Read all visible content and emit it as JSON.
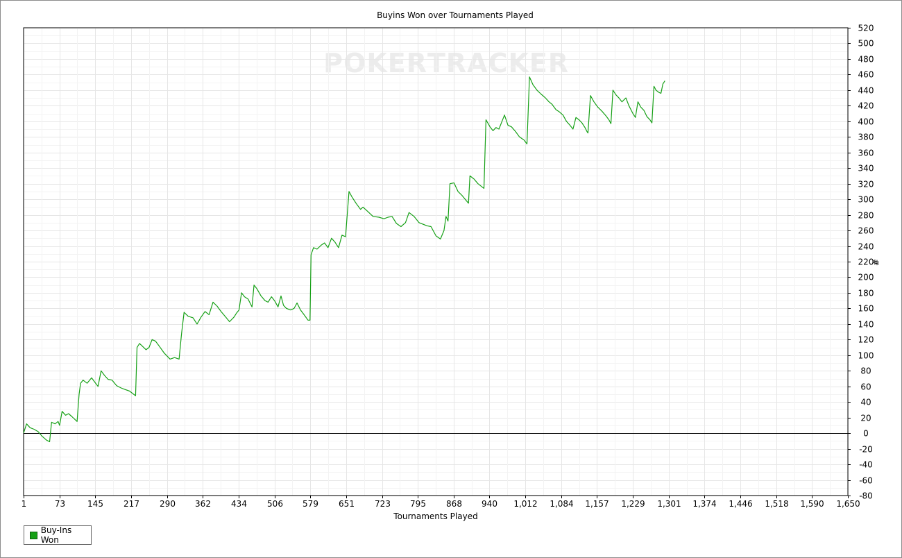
{
  "chart_data": {
    "type": "line",
    "title": "Buyins Won over Tournaments Played",
    "xlabel": "Tournaments Played",
    "ylabel": "#",
    "watermark": {
      "left": "POKER",
      "right": "TRACKER"
    },
    "xlim": [
      1,
      1650
    ],
    "ylim": [
      -80,
      520
    ],
    "x_ticks": [
      "1",
      "73",
      "145",
      "217",
      "290",
      "362",
      "434",
      "506",
      "579",
      "651",
      "723",
      "795",
      "868",
      "940",
      "1,012",
      "1,084",
      "1,157",
      "1,229",
      "1,301",
      "1,374",
      "1,446",
      "1,518",
      "1,590",
      "1,650"
    ],
    "y_ticks": [
      520,
      500,
      480,
      460,
      440,
      420,
      400,
      380,
      360,
      340,
      320,
      300,
      280,
      260,
      240,
      220,
      200,
      180,
      160,
      140,
      120,
      100,
      80,
      60,
      40,
      20,
      0,
      -20,
      -40,
      -60,
      -80
    ],
    "grid": true,
    "legend_position": "bottom-left",
    "color": "#16a016",
    "series": [
      {
        "name": "Buy-Ins Won",
        "points": [
          [
            1,
            0
          ],
          [
            7,
            12
          ],
          [
            14,
            7
          ],
          [
            22,
            5
          ],
          [
            30,
            2
          ],
          [
            38,
            -4
          ],
          [
            47,
            -9
          ],
          [
            53,
            -11
          ],
          [
            57,
            14
          ],
          [
            64,
            12
          ],
          [
            70,
            15
          ],
          [
            73,
            10
          ],
          [
            78,
            28
          ],
          [
            85,
            23
          ],
          [
            91,
            25
          ],
          [
            98,
            21
          ],
          [
            108,
            15
          ],
          [
            112,
            50
          ],
          [
            115,
            64
          ],
          [
            120,
            68
          ],
          [
            128,
            64
          ],
          [
            137,
            71
          ],
          [
            144,
            65
          ],
          [
            150,
            60
          ],
          [
            156,
            80
          ],
          [
            163,
            74
          ],
          [
            170,
            69
          ],
          [
            178,
            68
          ],
          [
            187,
            61
          ],
          [
            196,
            58
          ],
          [
            204,
            56
          ],
          [
            213,
            54
          ],
          [
            225,
            48
          ],
          [
            228,
            110
          ],
          [
            233,
            115
          ],
          [
            238,
            112
          ],
          [
            246,
            107
          ],
          [
            252,
            110
          ],
          [
            258,
            120
          ],
          [
            265,
            118
          ],
          [
            272,
            112
          ],
          [
            282,
            103
          ],
          [
            294,
            95
          ],
          [
            303,
            97
          ],
          [
            312,
            95
          ],
          [
            317,
            128
          ],
          [
            322,
            155
          ],
          [
            330,
            150
          ],
          [
            340,
            148
          ],
          [
            348,
            140
          ],
          [
            356,
            149
          ],
          [
            364,
            156
          ],
          [
            372,
            152
          ],
          [
            380,
            168
          ],
          [
            388,
            163
          ],
          [
            396,
            156
          ],
          [
            404,
            150
          ],
          [
            413,
            143
          ],
          [
            422,
            149
          ],
          [
            427,
            154
          ],
          [
            432,
            158
          ],
          [
            437,
            180
          ],
          [
            443,
            175
          ],
          [
            450,
            172
          ],
          [
            458,
            162
          ],
          [
            462,
            190
          ],
          [
            468,
            185
          ],
          [
            476,
            176
          ],
          [
            484,
            170
          ],
          [
            490,
            168
          ],
          [
            497,
            175
          ],
          [
            503,
            170
          ],
          [
            510,
            162
          ],
          [
            516,
            176
          ],
          [
            521,
            164
          ],
          [
            527,
            160
          ],
          [
            535,
            158
          ],
          [
            542,
            160
          ],
          [
            548,
            167
          ],
          [
            555,
            158
          ],
          [
            562,
            152
          ],
          [
            570,
            145
          ],
          [
            574,
            145
          ],
          [
            576,
            229
          ],
          [
            581,
            238
          ],
          [
            588,
            236
          ],
          [
            596,
            241
          ],
          [
            603,
            244
          ],
          [
            610,
            238
          ],
          [
            617,
            250
          ],
          [
            624,
            245
          ],
          [
            631,
            238
          ],
          [
            638,
            254
          ],
          [
            645,
            252
          ],
          [
            652,
            310
          ],
          [
            658,
            303
          ],
          [
            666,
            295
          ],
          [
            675,
            287
          ],
          [
            680,
            290
          ],
          [
            690,
            284
          ],
          [
            700,
            278
          ],
          [
            712,
            277
          ],
          [
            722,
            275
          ],
          [
            730,
            277
          ],
          [
            738,
            278
          ],
          [
            747,
            269
          ],
          [
            756,
            265
          ],
          [
            765,
            270
          ],
          [
            772,
            283
          ],
          [
            782,
            278
          ],
          [
            792,
            270
          ],
          [
            800,
            268
          ],
          [
            808,
            266
          ],
          [
            816,
            265
          ],
          [
            826,
            253
          ],
          [
            835,
            249
          ],
          [
            842,
            260
          ],
          [
            846,
            278
          ],
          [
            850,
            272
          ],
          [
            854,
            320
          ],
          [
            862,
            321
          ],
          [
            870,
            310
          ],
          [
            878,
            305
          ],
          [
            887,
            298
          ],
          [
            891,
            295
          ],
          [
            894,
            330
          ],
          [
            902,
            326
          ],
          [
            910,
            320
          ],
          [
            918,
            316
          ],
          [
            922,
            314
          ],
          [
            926,
            402
          ],
          [
            934,
            393
          ],
          [
            940,
            388
          ],
          [
            946,
            392
          ],
          [
            952,
            390
          ],
          [
            958,
            400
          ],
          [
            963,
            408
          ],
          [
            970,
            395
          ],
          [
            977,
            393
          ],
          [
            985,
            387
          ],
          [
            993,
            380
          ],
          [
            1002,
            376
          ],
          [
            1008,
            371
          ],
          [
            1013,
            457
          ],
          [
            1020,
            447
          ],
          [
            1028,
            440
          ],
          [
            1036,
            435
          ],
          [
            1045,
            430
          ],
          [
            1052,
            425
          ],
          [
            1058,
            422
          ],
          [
            1066,
            415
          ],
          [
            1073,
            412
          ],
          [
            1080,
            408
          ],
          [
            1087,
            400
          ],
          [
            1094,
            395
          ],
          [
            1100,
            390
          ],
          [
            1106,
            405
          ],
          [
            1112,
            402
          ],
          [
            1118,
            398
          ],
          [
            1124,
            392
          ],
          [
            1128,
            387
          ],
          [
            1130,
            385
          ],
          [
            1135,
            433
          ],
          [
            1142,
            425
          ],
          [
            1150,
            418
          ],
          [
            1158,
            413
          ],
          [
            1166,
            407
          ],
          [
            1172,
            402
          ],
          [
            1176,
            397
          ],
          [
            1180,
            440
          ],
          [
            1186,
            434
          ],
          [
            1192,
            430
          ],
          [
            1198,
            425
          ],
          [
            1206,
            430
          ],
          [
            1212,
            420
          ],
          [
            1220,
            410
          ],
          [
            1225,
            405
          ],
          [
            1230,
            425
          ],
          [
            1236,
            418
          ],
          [
            1242,
            414
          ],
          [
            1248,
            406
          ],
          [
            1254,
            402
          ],
          [
            1258,
            398
          ],
          [
            1262,
            445
          ],
          [
            1266,
            440
          ],
          [
            1272,
            437
          ],
          [
            1276,
            436
          ],
          [
            1280,
            448
          ],
          [
            1284,
            452
          ]
        ]
      }
    ]
  }
}
